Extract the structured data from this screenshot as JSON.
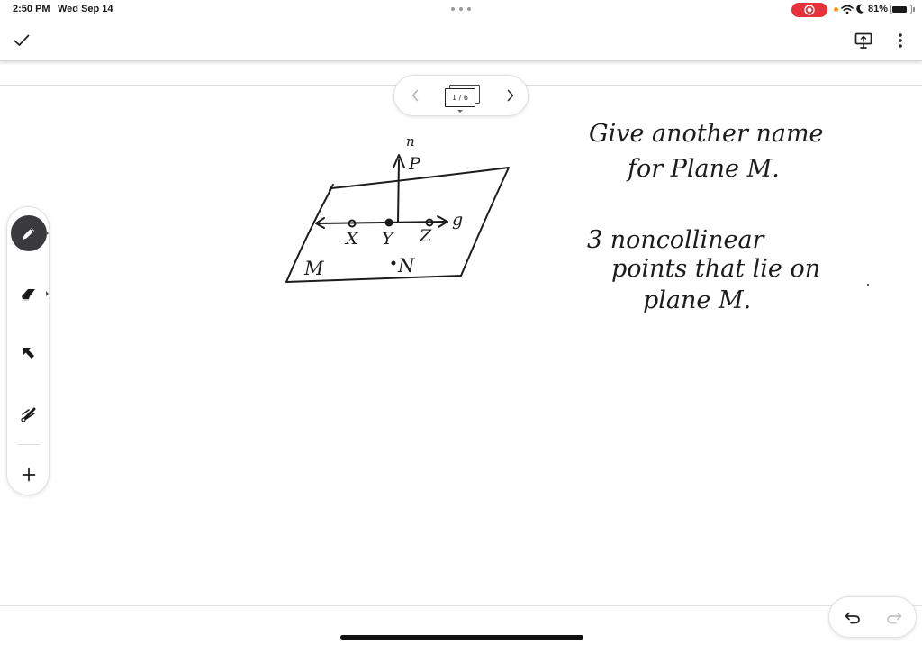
{
  "status_bar": {
    "time": "2:50 PM",
    "date": "Wed Sep 14",
    "battery_percent": "81%",
    "battery_level": 0.81,
    "record_color": "#e8323a"
  },
  "toolbar": {
    "done_icon": "checkmark-icon",
    "present_icon": "present-screen-icon",
    "more_icon": "more-vertical-icon"
  },
  "page_nav": {
    "page_indicator": "1 / 6",
    "prev_icon": "chevron-left-icon",
    "next_icon": "chevron-right-icon"
  },
  "tools": [
    {
      "name": "pen",
      "icon": "pen-icon",
      "active": true
    },
    {
      "name": "eraser",
      "icon": "eraser-icon",
      "active": false
    },
    {
      "name": "select",
      "icon": "arrow-cursor-icon",
      "active": false
    },
    {
      "name": "laser",
      "icon": "laser-pointer-icon",
      "active": false
    },
    {
      "name": "add",
      "icon": "plus-icon",
      "active": false
    }
  ],
  "undo_redo": {
    "undo_icon": "undo-icon",
    "redo_icon": "redo-icon",
    "redo_enabled": false
  },
  "handwriting": {
    "diagram_labels": {
      "ray_top": "n",
      "point_p": "P",
      "line_label": "g",
      "point_x": "X",
      "point_y": "Y",
      "point_z": "Z",
      "plane": "M",
      "point_n": "N"
    },
    "question_1": [
      "Give another name",
      "for Plane M."
    ],
    "question_2": [
      "3 noncollinear",
      "points that lie on",
      "plane M."
    ]
  }
}
